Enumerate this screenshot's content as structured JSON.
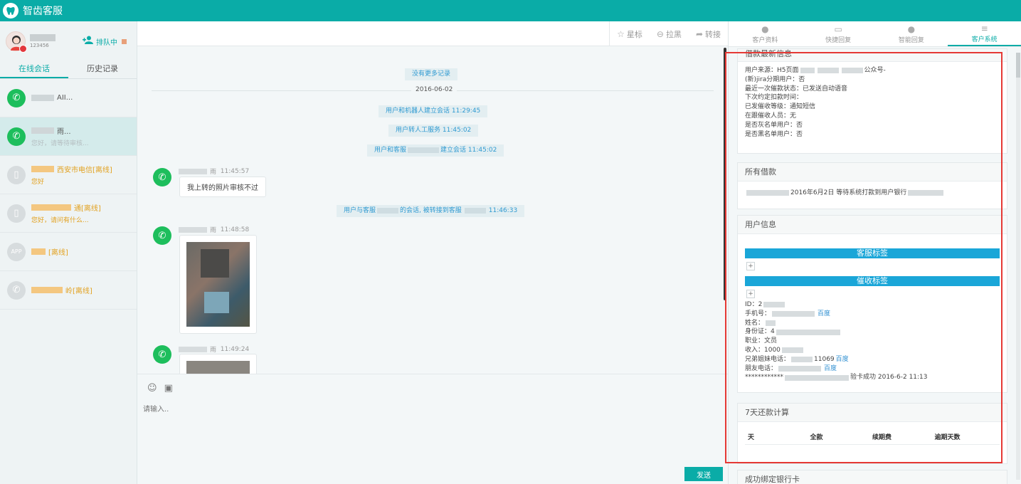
{
  "app": {
    "title": "智齿客服"
  },
  "agent": {
    "sub": "123456",
    "queue_label": "排队中"
  },
  "left_tabs": [
    "在线会话",
    "历史记录"
  ],
  "sessions": [
    {
      "name": "AII...",
      "preview": "",
      "icon": "wechat",
      "offline": false,
      "active": false
    },
    {
      "name": "雨...",
      "preview": "您好，请等待审核...",
      "icon": "wechat",
      "offline": false,
      "active": true
    },
    {
      "name": "西安市电信[离线]",
      "preview": "您好",
      "icon": "phone",
      "offline": true,
      "active": false
    },
    {
      "name": "通[离线]",
      "preview": "您好，请问有什么...",
      "icon": "phone",
      "offline": true,
      "active": false
    },
    {
      "name": "[离线]",
      "preview": "",
      "icon": "app",
      "offline": true,
      "active": false
    },
    {
      "name": "岭[离线]",
      "preview": "",
      "icon": "wechat-gray",
      "offline": true,
      "active": false
    }
  ],
  "chat_actions": [
    {
      "icon": "star-icon",
      "glyph": "☆",
      "label": "星标"
    },
    {
      "icon": "block-icon",
      "glyph": "⊖",
      "label": "拉黑"
    },
    {
      "icon": "transfer-icon",
      "glyph": "➦",
      "label": "转接"
    }
  ],
  "chat": {
    "no_more": "没有更多记录",
    "date": "2016-06-02",
    "sys1": "用户和机器人建立会话 11:29:45",
    "sys2": "用户转人工服务 11:45:02",
    "sys3_a": "用户和客服",
    "sys3_b": "建立会话 11:45:02",
    "msg1_meta_name": "雨",
    "msg1_time": "11:45:57",
    "msg1_text": "我上转的照片审核不过",
    "sys4_a": "用户与客服",
    "sys4_b": "的会话, 被转接到客服",
    "sys4_c": "11:46:33",
    "msg2_meta_name": "雨",
    "msg2_time": "11:48:58",
    "msg3_meta_name": "雨",
    "msg3_time": "11:49:24"
  },
  "composer": {
    "placeholder": "请输入..",
    "send_label": "发送"
  },
  "right_tabs": [
    {
      "icon": "user-icon",
      "glyph": "👤",
      "label": "客户资料"
    },
    {
      "icon": "chat-icon",
      "glyph": "▭",
      "label": "快捷回复"
    },
    {
      "icon": "bulb-icon",
      "glyph": "●",
      "label": "智能回复"
    },
    {
      "icon": "list-icon",
      "glyph": "≡",
      "label": "客户系统"
    }
  ],
  "loan_info": {
    "title": "借款最新信息",
    "source_label": "用户来源：H5页面",
    "source_tail": "公众号-",
    "new_user": "(新)jira分期用户：",
    "new_user_val": "否",
    "last_status": "最近一次催款状态：已发送自动语音",
    "next_time": "下次约定扣款时间：",
    "level": "已发催收等级：通知短信",
    "collector": "在跟催收人员：无",
    "gray": "是否灰名单用户：否",
    "black": "是否黑名单用户：否"
  },
  "all_loans": {
    "title": "所有借款",
    "text": "2016年6月2日 等待系统打款到用户银行"
  },
  "user_info": {
    "title": "用户信息",
    "cs_tag": "客服标签",
    "collect_tag": "催收标签",
    "plus": "+",
    "id_label": "ID：2",
    "phone_label": "手机号：",
    "baidu": "百度",
    "name_label": "姓名：",
    "idcard_label": "身份证：4",
    "job_label": "职业：文员",
    "income_label": "收入：1000",
    "sibling_label": "兄弟姐妹电话：",
    "sibling_tail": "11069",
    "friend_label": "朋友电话：",
    "stars": "************",
    "card_tail": "验卡成功 2016-6-2 11:13"
  },
  "repay": {
    "title": "7天还款计算",
    "headers": [
      "天",
      "全款",
      "续期费",
      "逾期天数"
    ]
  },
  "bound_card": {
    "title": "成功绑定银行卡"
  }
}
